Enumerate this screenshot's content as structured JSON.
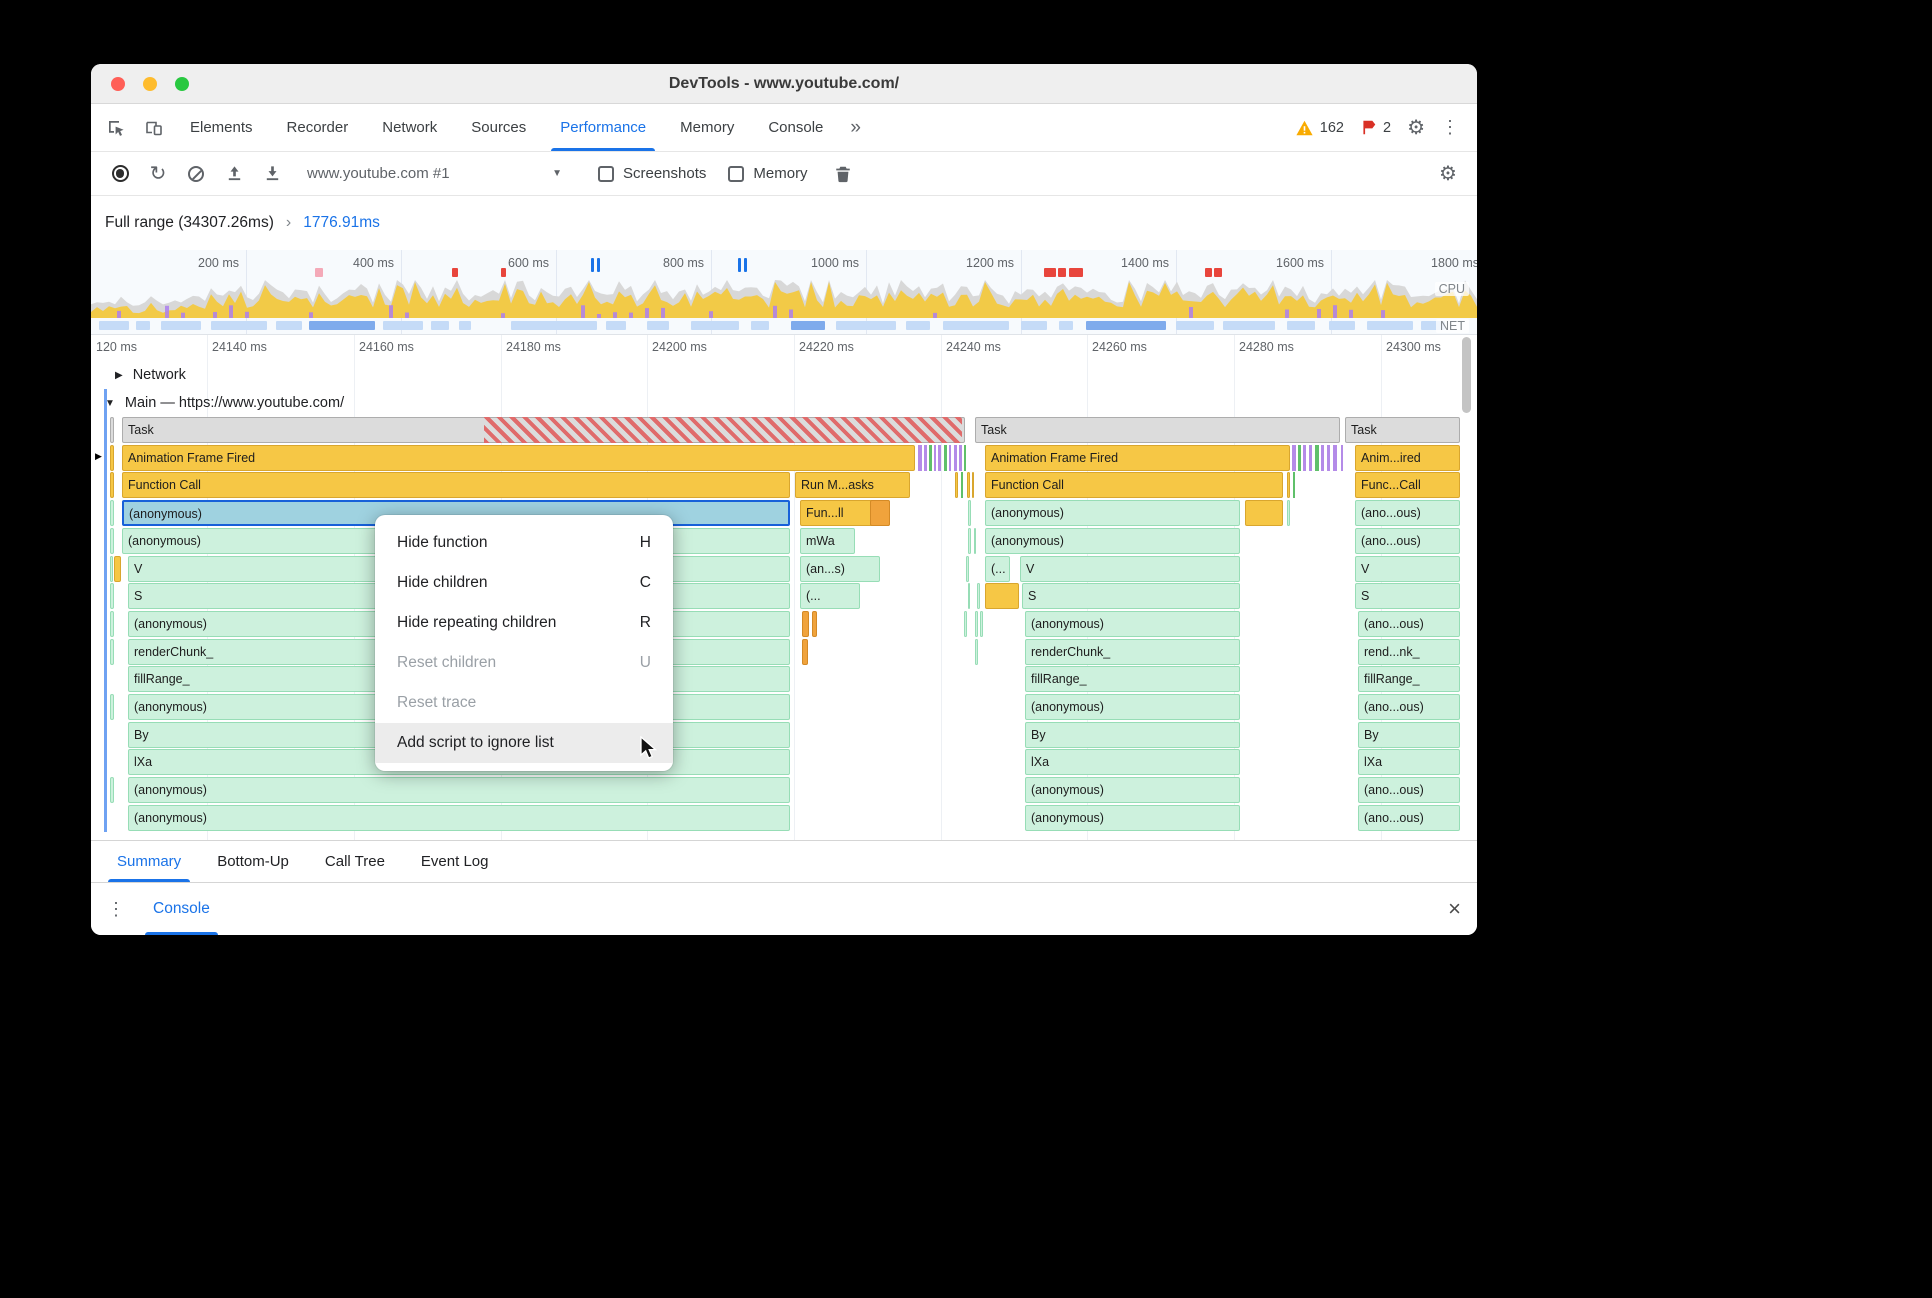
{
  "window": {
    "title": "DevTools - www.youtube.com/"
  },
  "tab_bar": {
    "tabs": [
      "Elements",
      "Recorder",
      "Network",
      "Sources",
      "Performance",
      "Memory",
      "Console"
    ],
    "active_tab": "Performance",
    "more_tabs_icon": "»",
    "warning_count": "162",
    "issue_count": "2"
  },
  "toolbar": {
    "history_selected": "www.youtube.com #1",
    "screenshots_label": "Screenshots",
    "memory_label": "Memory"
  },
  "range_bar": {
    "full_range": "Full range (34307.26ms)",
    "separator": "›",
    "selection": "1776.91ms"
  },
  "overview": {
    "ticks": [
      "200 ms",
      "400 ms",
      "600 ms",
      "800 ms",
      "1000 ms",
      "1200 ms",
      "1400 ms",
      "1600 ms",
      "1800 ms"
    ],
    "cpu_label": "CPU",
    "net_label": "NET"
  },
  "ruler": {
    "ticks": [
      "120 ms",
      "24140 ms",
      "24160 ms",
      "24180 ms",
      "24200 ms",
      "24220 ms",
      "24240 ms",
      "24260 ms",
      "24280 ms",
      "24300 ms"
    ]
  },
  "tracks": {
    "network_label": "Network",
    "main_label": "Main — https://www.youtube.com/"
  },
  "flame": {
    "segments": [
      [
        0,
        19,
        4,
        "task",
        ""
      ],
      [
        0,
        31,
        843,
        "task",
        "Task"
      ],
      [
        0,
        393,
        478,
        "stripe",
        ""
      ],
      [
        0,
        884,
        365,
        "task",
        "Task"
      ],
      [
        0,
        1254,
        115,
        "task",
        "Task"
      ],
      [
        1,
        19,
        4,
        "afff",
        ""
      ],
      [
        1,
        31,
        793,
        "afff",
        "Animation Frame Fired"
      ],
      [
        1,
        827,
        4,
        "purple",
        ""
      ],
      [
        1,
        833,
        3,
        "purple",
        ""
      ],
      [
        1,
        838,
        3,
        "green3",
        ""
      ],
      [
        1,
        843,
        2,
        "purple",
        ""
      ],
      [
        1,
        847,
        3,
        "purple",
        ""
      ],
      [
        1,
        853,
        3,
        "green3",
        ""
      ],
      [
        1,
        858,
        2,
        "purple",
        ""
      ],
      [
        1,
        863,
        3,
        "purple",
        ""
      ],
      [
        1,
        868,
        3,
        "purple",
        ""
      ],
      [
        1,
        873,
        2,
        "green3",
        ""
      ],
      [
        1,
        894,
        305,
        "afff",
        "Animation Frame Fired"
      ],
      [
        1,
        1201,
        4,
        "purple",
        ""
      ],
      [
        1,
        1207,
        3,
        "green3",
        ""
      ],
      [
        1,
        1212,
        3,
        "purple",
        ""
      ],
      [
        1,
        1218,
        3,
        "purple",
        ""
      ],
      [
        1,
        1224,
        4,
        "green3",
        ""
      ],
      [
        1,
        1230,
        3,
        "purple",
        ""
      ],
      [
        1,
        1236,
        3,
        "purple",
        ""
      ],
      [
        1,
        1242,
        4,
        "purple",
        ""
      ],
      [
        1,
        1250,
        2,
        "purple",
        ""
      ],
      [
        1,
        1264,
        105,
        "afff",
        "Anim...ired"
      ],
      [
        2,
        19,
        4,
        "afff",
        ""
      ],
      [
        2,
        31,
        668,
        "afff",
        "Function Call"
      ],
      [
        2,
        704,
        115,
        "afff",
        "Run M...asks"
      ],
      [
        2,
        864,
        3,
        "afff",
        ""
      ],
      [
        2,
        870,
        2,
        "green3",
        ""
      ],
      [
        2,
        876,
        3,
        "afff",
        ""
      ],
      [
        2,
        881,
        2,
        "afff",
        ""
      ],
      [
        2,
        894,
        298,
        "afff",
        "Function Call"
      ],
      [
        2,
        1196,
        3,
        "afff",
        ""
      ],
      [
        2,
        1202,
        2,
        "green3",
        ""
      ],
      [
        2,
        1264,
        105,
        "afff",
        "Func...Call"
      ],
      [
        3,
        19,
        4,
        "js",
        ""
      ],
      [
        3,
        31,
        668,
        "sel",
        "(anonymous)"
      ],
      [
        3,
        709,
        90,
        "afff",
        "Fun...ll"
      ],
      [
        3,
        779,
        20,
        "orange",
        ""
      ],
      [
        3,
        877,
        3,
        "js",
        ""
      ],
      [
        3,
        894,
        255,
        "js",
        "(anonymous)"
      ],
      [
        3,
        1154,
        38,
        "afff",
        ""
      ],
      [
        3,
        1196,
        3,
        "js",
        ""
      ],
      [
        3,
        1264,
        105,
        "js",
        "(ano...ous)"
      ],
      [
        4,
        19,
        4,
        "js",
        ""
      ],
      [
        4,
        31,
        668,
        "js",
        "(anonymous)"
      ],
      [
        4,
        709,
        55,
        "js",
        "mWa"
      ],
      [
        4,
        877,
        3,
        "js",
        ""
      ],
      [
        4,
        883,
        2,
        "js",
        ""
      ],
      [
        4,
        894,
        255,
        "js",
        "(anonymous)"
      ],
      [
        4,
        1264,
        105,
        "js",
        "(ano...ous)"
      ],
      [
        5,
        19,
        3,
        "js",
        ""
      ],
      [
        5,
        23,
        7,
        "afff",
        ""
      ],
      [
        5,
        37,
        662,
        "js",
        "V"
      ],
      [
        5,
        709,
        80,
        "js",
        "(an...s)"
      ],
      [
        5,
        875,
        3,
        "js",
        ""
      ],
      [
        5,
        894,
        25,
        "js",
        "(..."
      ],
      [
        5,
        929,
        220,
        "js",
        "V"
      ],
      [
        5,
        1264,
        105,
        "js",
        "V"
      ],
      [
        6,
        19,
        4,
        "js",
        ""
      ],
      [
        6,
        37,
        662,
        "js",
        "S"
      ],
      [
        6,
        709,
        60,
        "js",
        "(..."
      ],
      [
        6,
        877,
        2,
        "js",
        ""
      ],
      [
        6,
        886,
        3,
        "js",
        ""
      ],
      [
        6,
        894,
        34,
        "afff",
        ""
      ],
      [
        6,
        931,
        218,
        "js",
        "S"
      ],
      [
        6,
        1264,
        105,
        "js",
        "S"
      ],
      [
        7,
        19,
        4,
        "js",
        ""
      ],
      [
        7,
        37,
        662,
        "js",
        "(anonymous)"
      ],
      [
        7,
        711,
        7,
        "orange",
        ""
      ],
      [
        7,
        721,
        5,
        "orange",
        ""
      ],
      [
        7,
        873,
        3,
        "js",
        ""
      ],
      [
        7,
        884,
        3,
        "js",
        ""
      ],
      [
        7,
        889,
        3,
        "js",
        ""
      ],
      [
        7,
        934,
        215,
        "js",
        "(anonymous)"
      ],
      [
        7,
        1267,
        102,
        "js",
        "(ano...ous)"
      ],
      [
        8,
        19,
        4,
        "js",
        ""
      ],
      [
        8,
        37,
        662,
        "js",
        "renderChunk_"
      ],
      [
        8,
        711,
        6,
        "orange",
        ""
      ],
      [
        8,
        884,
        3,
        "js",
        ""
      ],
      [
        8,
        934,
        215,
        "js",
        "renderChunk_"
      ],
      [
        8,
        1267,
        102,
        "js",
        "rend...nk_"
      ],
      [
        9,
        37,
        662,
        "js",
        "fillRange_"
      ],
      [
        9,
        934,
        215,
        "js",
        "fillRange_"
      ],
      [
        9,
        1267,
        102,
        "js",
        "fillRange_"
      ],
      [
        10,
        19,
        4,
        "js",
        ""
      ],
      [
        10,
        37,
        662,
        "js",
        "(anonymous)"
      ],
      [
        10,
        934,
        215,
        "js",
        "(anonymous)"
      ],
      [
        10,
        1267,
        102,
        "js",
        "(ano...ous)"
      ],
      [
        11,
        37,
        662,
        "js",
        "By"
      ],
      [
        11,
        934,
        215,
        "js",
        "By"
      ],
      [
        11,
        1267,
        102,
        "js",
        "By"
      ],
      [
        12,
        37,
        662,
        "js",
        "lXa"
      ],
      [
        12,
        934,
        215,
        "js",
        "lXa"
      ],
      [
        12,
        1267,
        102,
        "js",
        "lXa"
      ],
      [
        13,
        19,
        4,
        "js",
        ""
      ],
      [
        13,
        37,
        662,
        "js",
        "(anonymous)"
      ],
      [
        13,
        934,
        215,
        "js",
        "(anonymous)"
      ],
      [
        13,
        1267,
        102,
        "js",
        "(ano...ous)"
      ],
      [
        14,
        37,
        662,
        "js",
        "(anonymous)"
      ],
      [
        14,
        934,
        215,
        "js",
        "(anonymous)"
      ],
      [
        14,
        1267,
        102,
        "js",
        "(ano...ous)"
      ]
    ]
  },
  "context_menu": {
    "items": [
      {
        "label": "Hide function",
        "shortcut": "H",
        "state": "normal"
      },
      {
        "label": "Hide children",
        "shortcut": "C",
        "state": "normal"
      },
      {
        "label": "Hide repeating children",
        "shortcut": "R",
        "state": "normal"
      },
      {
        "label": "Reset children",
        "shortcut": "U",
        "state": "disabled"
      },
      {
        "label": "Reset trace",
        "shortcut": "",
        "state": "disabled"
      },
      {
        "label": "Add script to ignore list",
        "shortcut": "",
        "state": "hover"
      }
    ]
  },
  "bottom_tabs": {
    "tabs": [
      "Summary",
      "Bottom-Up",
      "Call Tree",
      "Event Log"
    ],
    "active_tab": "Summary"
  },
  "drawer": {
    "console_label": "Console"
  }
}
